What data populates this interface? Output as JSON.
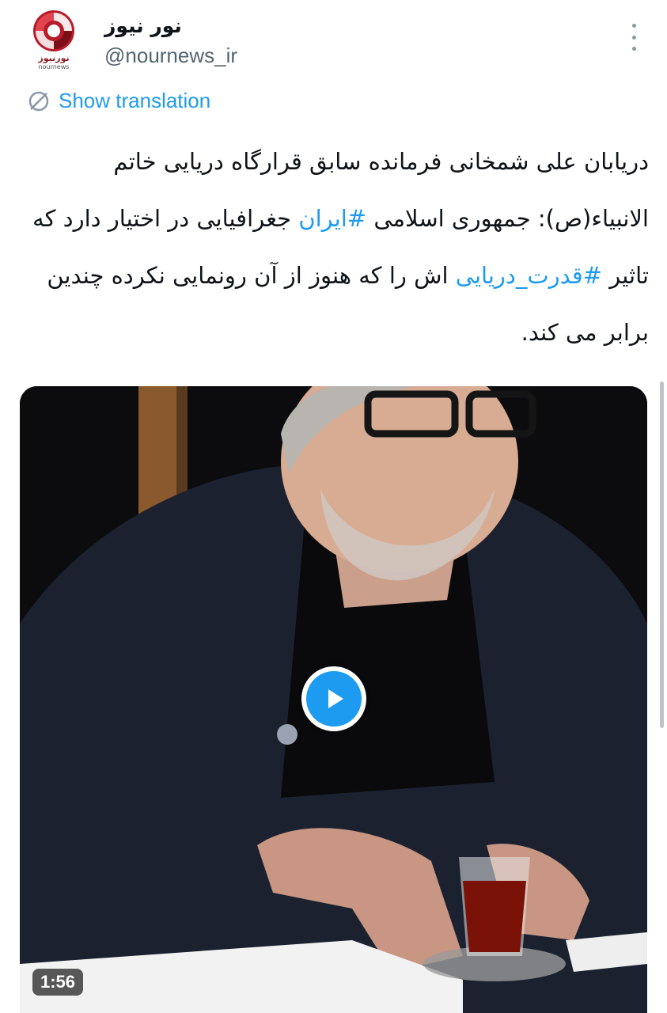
{
  "account": {
    "display_name": "نور نیوز",
    "handle": "@nournews_ir",
    "avatar_brand_fa": "نورنیوز",
    "avatar_brand_en": "nournews"
  },
  "actions": {
    "more_icon": "more-vertical-icon",
    "show_translation": "Show translation",
    "translate_icon": "translate-icon"
  },
  "tweet": {
    "text_part1": "دریابان علی شمخانی فرمانده سابق قرارگاه دریایی خاتم الانبیاء(ص): جمهوری اسلامی ",
    "hashtag1": "#ایران",
    "text_part2": " جغرافیایی در اختیار دارد که تاثیر ",
    "hashtag2": "#قدرت_دریایی",
    "text_part3": " اش را که هنوز از آن رونمایی نکرده چندین برابر می کند."
  },
  "media": {
    "type": "video",
    "duration": "1:56",
    "play_icon": "play-icon"
  },
  "colors": {
    "accent": "#1d9bf0",
    "text": "#0f1419",
    "secondary": "#536471"
  }
}
